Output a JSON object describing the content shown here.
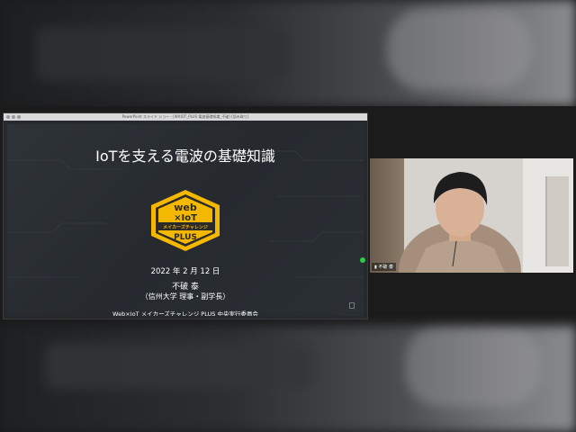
{
  "share_window": {
    "title": "PowerPoint スライド ショー - [WXIOT_PLUS 電波基礎知識_不破] [読み取り]"
  },
  "slide": {
    "title": "IoTを支える電波の基礎知識",
    "logo": {
      "line1": "web",
      "line2": "×IoT",
      "line3": "メイカーズチャレンジ",
      "line4": "PLUS"
    },
    "date": "2022 年 2 月 12 日",
    "presenter": "不破 泰",
    "affiliation": "（信州大学 理事・副学長）",
    "organizer": "Web×IoT メイカーズチャレンジ PLUS 中央実行委員会"
  },
  "video": {
    "participant_name": "不破 泰"
  },
  "colors": {
    "logo_yellow": "#f5b800",
    "logo_dark": "#2a2a2a",
    "active_indicator": "#2ecc40"
  }
}
